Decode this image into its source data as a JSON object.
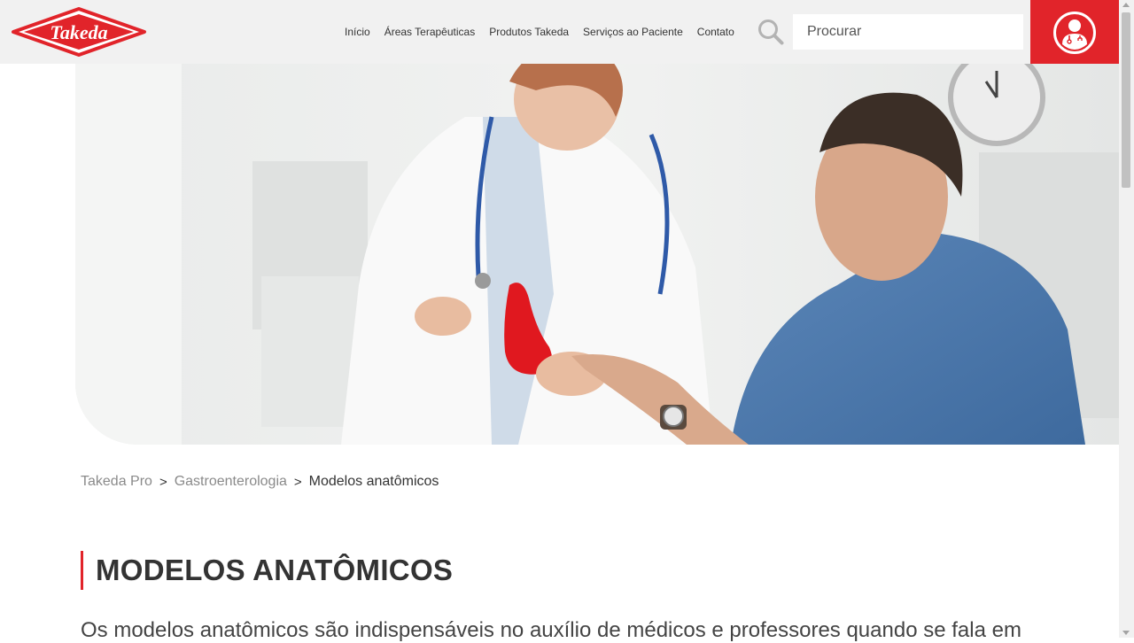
{
  "brand": {
    "logo_text": "Takeda"
  },
  "nav": {
    "items": [
      {
        "label": "Início"
      },
      {
        "label": "Áreas Terapêuticas"
      },
      {
        "label": "Produtos Takeda"
      },
      {
        "label": "Serviços ao Paciente"
      },
      {
        "label": "Contato"
      }
    ]
  },
  "search": {
    "placeholder": "Procurar",
    "icon": "search-icon"
  },
  "pro_button": {
    "icon": "doctor-profile-icon"
  },
  "colors": {
    "brand_red": "#e1242a",
    "header_bg": "#f1f1f1",
    "text": "#333333"
  },
  "breadcrumb": {
    "items": [
      {
        "label": "Takeda Pro"
      },
      {
        "label": "Gastroenterologia"
      }
    ],
    "separator": ">",
    "current": "Modelos anatômicos"
  },
  "page": {
    "title": "MODELOS ANATÔMICOS",
    "intro": "Os modelos anatômicos são indispensáveis no auxílio de médicos e professores quando se fala em"
  }
}
